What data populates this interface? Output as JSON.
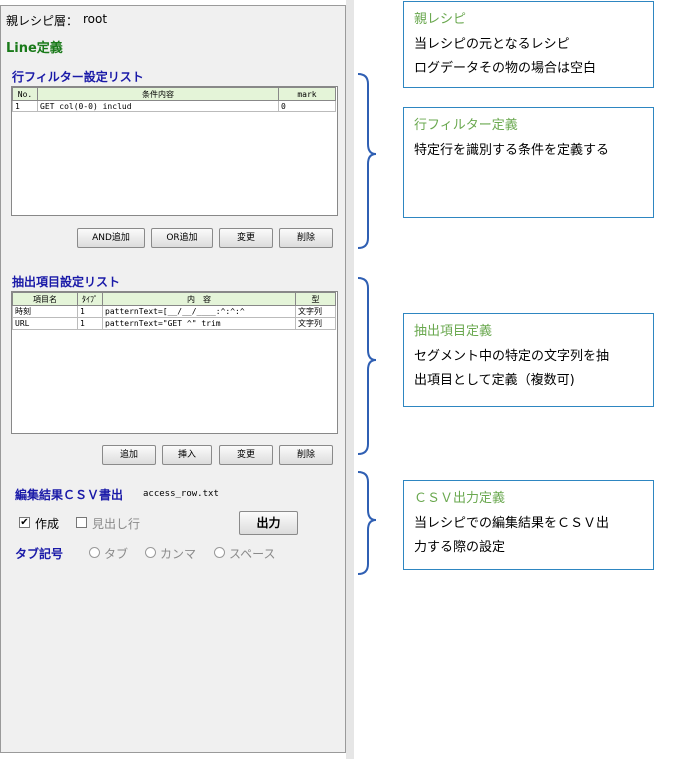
{
  "panel": {
    "parent_label": "親レシピ層：",
    "parent_value": "root",
    "line_def": "Line定義",
    "row_filter": {
      "title": "行フィルター設定リスト",
      "columns": [
        "No.",
        "条件内容",
        "mark"
      ],
      "rows": [
        [
          "1",
          "GET col(0-0) includ",
          "0"
        ]
      ],
      "buttons": [
        "AND追加",
        "OR追加",
        "変更",
        "削除"
      ]
    },
    "extract": {
      "title": "抽出項目設定リスト",
      "columns": [
        "項目名",
        "ﾀｲﾌﾟ",
        "内　容",
        "型"
      ],
      "rows": [
        [
          "時刻",
          "1",
          "patternText=[__/__/____:^:^:^",
          "文字列"
        ],
        [
          "URL",
          "1",
          "patternText=\"GET ^\" trim",
          "文字列"
        ]
      ],
      "buttons": [
        "追加",
        "挿入",
        "変更",
        "削除"
      ]
    },
    "csv": {
      "title": "編集結果ＣＳＶ書出",
      "filename": "access_row.txt",
      "create_label": "作成",
      "create_checked": true,
      "heading_label": "見出し行",
      "heading_checked": false,
      "output_button": "出力",
      "tab_label": "タブ記号",
      "radios": [
        "タブ",
        "カンマ",
        "スペース"
      ]
    }
  },
  "callouts": [
    {
      "title": "親レシピ",
      "lines": [
        "当レシピの元となるレシピ",
        "ログデータその物の場合は空白"
      ]
    },
    {
      "title": "行フィルター定義",
      "lines": [
        "特定行を識別する条件を定義する"
      ]
    },
    {
      "title": "抽出項目定義",
      "lines": [
        "セグメント中の特定の文字列を抽",
        "出項目として定義（複数可)"
      ]
    },
    {
      "title": "ＣＳＶ出力定義",
      "lines": [
        "当レシピでの編集結果をＣＳＶ出",
        "力する際の設定"
      ]
    }
  ],
  "colors": {
    "section_title": "#1a1aa8",
    "callout_border": "#2e86c1",
    "callout_title": "#6aa84f",
    "bracket": "#2f5fb3"
  }
}
